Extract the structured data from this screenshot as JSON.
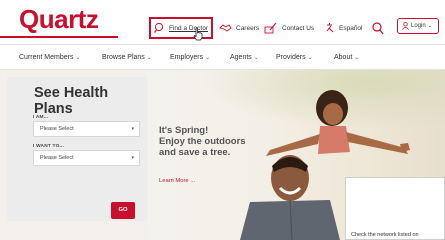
{
  "brand": {
    "logo_text": "Quartz",
    "accent": "#c8102e"
  },
  "utility": {
    "find_doctor": "Find a Doctor",
    "careers": "Careers",
    "contact": "Contact Us",
    "espanol": "Español",
    "login": "Login",
    "login_caret": "⌄"
  },
  "nav": {
    "items": [
      {
        "label": "Current Members",
        "caret": "⌄"
      },
      {
        "label": "Browse Plans",
        "caret": "⌄"
      },
      {
        "label": "Employers",
        "caret": "⌄"
      },
      {
        "label": "Agents",
        "caret": "⌄"
      },
      {
        "label": "Providers",
        "caret": "⌄"
      },
      {
        "label": "About",
        "caret": "⌄"
      }
    ]
  },
  "plans_panel": {
    "title": "See Health Plans",
    "i_am_label": "I AM...",
    "i_am_value": "Please Select",
    "i_want_label": "I WANT TO...",
    "i_want_value": "Please Select",
    "go_label": "GO"
  },
  "promo": {
    "line1": "It's Spring!",
    "line2": "Enjoy the outdoors",
    "line3": "and save a tree.",
    "link": "Learn More ..."
  },
  "modal": {
    "text": "Check the network listed on"
  }
}
